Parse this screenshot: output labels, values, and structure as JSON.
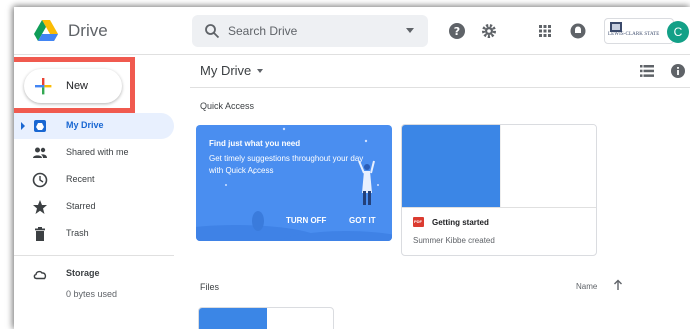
{
  "header": {
    "app_name": "Drive",
    "search_placeholder": "Search Drive",
    "org_name": "LEWIS-CLARK STATE",
    "avatar_letter": "C"
  },
  "sidebar": {
    "new_label": "New",
    "items": [
      {
        "label": "My Drive",
        "icon": "my-drive-icon",
        "active": true
      },
      {
        "label": "Shared with me",
        "icon": "shared-people-icon"
      },
      {
        "label": "Recent",
        "icon": "clock-icon"
      },
      {
        "label": "Starred",
        "icon": "star-icon"
      },
      {
        "label": "Trash",
        "icon": "trash-icon"
      }
    ],
    "storage_label": "Storage",
    "storage_used": "0 bytes used"
  },
  "main": {
    "title": "My Drive",
    "quick_access_label": "Quick Access",
    "promo": {
      "title": "Find just what you need",
      "desc": "Get timely suggestions throughout your day with Quick Access",
      "turn_off": "TURN OFF",
      "got_it": "GOT IT"
    },
    "card": {
      "file_type": "PDF",
      "title": "Getting started",
      "subtitle": "Summer Kibbe created"
    },
    "files_label": "Files",
    "sort_column": "Name"
  },
  "colors": {
    "accent": "#1967d2",
    "promo_bg": "#4a8ef0",
    "highlight_box": "#f05a4f",
    "avatar": "#13a087"
  }
}
